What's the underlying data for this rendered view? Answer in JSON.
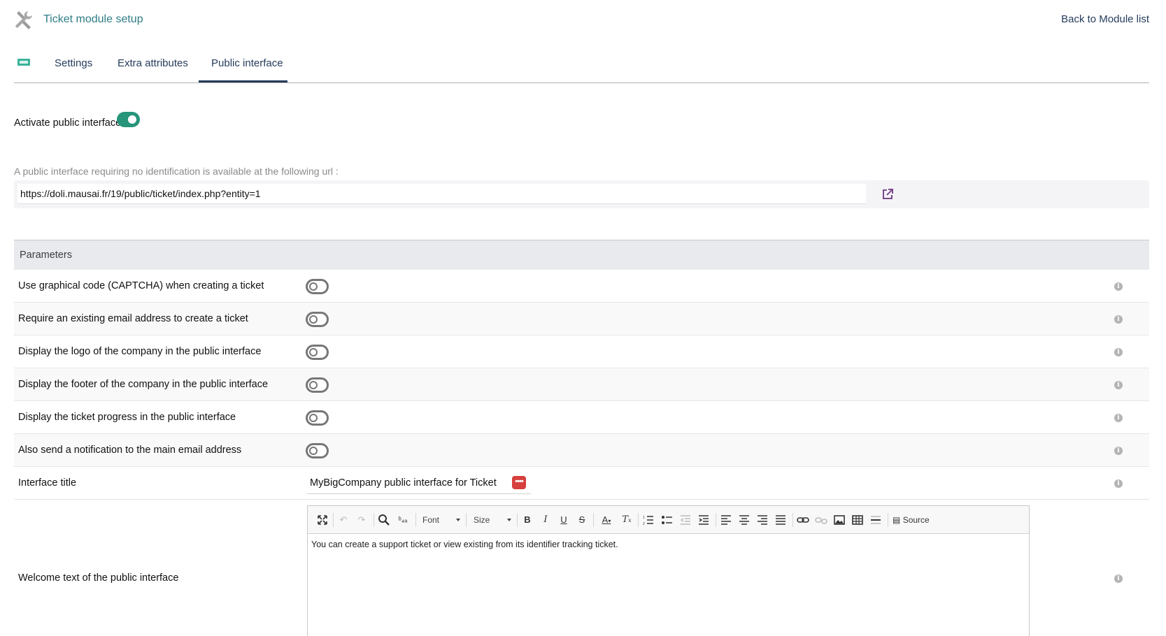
{
  "header": {
    "title": "Ticket module setup",
    "back_link": "Back to Module list",
    "icon": "tools-icon"
  },
  "tabs": {
    "icon": "ticket-icon",
    "items": [
      {
        "label": "Settings",
        "active": false
      },
      {
        "label": "Extra attributes",
        "active": false
      },
      {
        "label": "Public interface",
        "active": true
      }
    ]
  },
  "activate": {
    "label": "Activate public interface",
    "enabled": true
  },
  "public_url": {
    "hint": "A public interface requiring no identification is available at the following url :",
    "value": "https://doli.mausai.fr/19/public/ticket/index.php?entity=1",
    "open_icon": "external-link-icon"
  },
  "parameters": {
    "heading": "Parameters",
    "rows": [
      {
        "label": "Use graphical code (CAPTCHA) when creating a ticket",
        "enabled": false
      },
      {
        "label": "Require an existing email address to create a ticket",
        "enabled": false
      },
      {
        "label": "Display the logo of the company in the public interface",
        "enabled": false
      },
      {
        "label": "Display the footer of the company in the public interface",
        "enabled": false
      },
      {
        "label": "Display the ticket progress in the public interface",
        "enabled": false
      },
      {
        "label": "Also send a notification to the main email address",
        "enabled": false
      }
    ],
    "interface_title": {
      "label": "Interface title",
      "value": "MyBigCompany public interface for Ticket",
      "translate_button": "••••"
    },
    "welcome": {
      "label": "Welcome text of the public interface",
      "text": "You can create a support ticket or view existing from its identifier tracking ticket."
    }
  },
  "editor_toolbar": {
    "font_label": "Font",
    "size_label": "Size",
    "source_label": "Source",
    "bold": "B",
    "italic": "I",
    "underline": "U",
    "strike": "S",
    "text_color": "A",
    "clear_format": "T"
  },
  "colors": {
    "accent": "#26957a",
    "link": "#263c5c",
    "title": "#2e7d86",
    "translate_button": "#d7403e"
  }
}
